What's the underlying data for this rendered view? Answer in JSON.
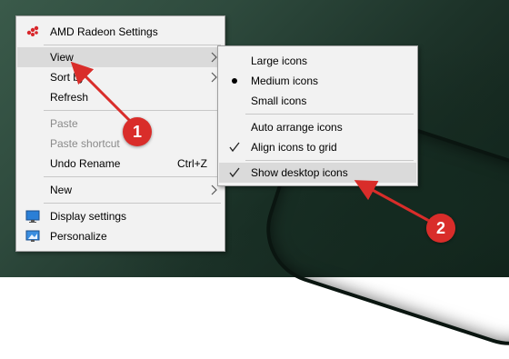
{
  "main_menu": {
    "amd_label": "AMD Radeon Settings",
    "view_label": "View",
    "sort_label": "Sort by",
    "refresh_label": "Refresh",
    "paste_label": "Paste",
    "paste_shortcut_label": "Paste shortcut",
    "undo_label": "Undo Rename",
    "undo_shortcut": "Ctrl+Z",
    "new_label": "New",
    "display_label": "Display settings",
    "personalize_label": "Personalize"
  },
  "view_submenu": {
    "large": "Large icons",
    "medium": "Medium icons",
    "small": "Small icons",
    "auto_arrange": "Auto arrange icons",
    "align": "Align icons to grid",
    "show_desktop": "Show desktop icons"
  },
  "annotations": {
    "badge1": "1",
    "badge2": "2"
  },
  "colors": {
    "annotation_red": "#d92d2a",
    "menu_bg": "#f2f2f2",
    "highlight": "#dadada",
    "amd_red": "#d8262b"
  },
  "icons": [
    "amd-logo-icon",
    "chevron-right-icon",
    "display-settings-icon",
    "personalize-icon",
    "check-icon"
  ]
}
